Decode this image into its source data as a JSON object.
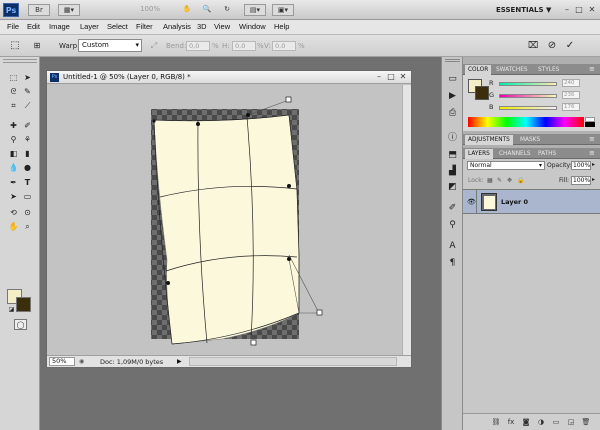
{
  "appbar": {
    "logo": "Ps",
    "zoom": "100%",
    "workspace": "ESSENTIALS",
    "workspace_arrow": "▼"
  },
  "menu": [
    "File",
    "Edit",
    "Image",
    "Layer",
    "Select",
    "Filter",
    "Analysis",
    "3D",
    "View",
    "Window",
    "Help"
  ],
  "options": {
    "warp_label": "Warp:",
    "warp_value": "Custom",
    "bend_label": "Bend:",
    "bend_value": "0,0",
    "h_label": "H:",
    "h_value": "0,0",
    "v_label": "V:",
    "v_value": "0,0",
    "pct": "%"
  },
  "document": {
    "title": "Untitled-1 @ 50% (Layer 0, RGB/8) *",
    "zoom": "50%",
    "doc_info": "Doc: 1,09M/0 bytes"
  },
  "color_panel": {
    "tabs": [
      "COLOR",
      "SWATCHES",
      "STYLES"
    ],
    "channels": [
      {
        "label": "R",
        "value": "240"
      },
      {
        "label": "G",
        "value": "236"
      },
      {
        "label": "B",
        "value": "176"
      }
    ],
    "fg_color": "#f3edc8",
    "bg_color": "#3a2e0c"
  },
  "adjustments_panel": {
    "tabs": [
      "ADJUSTMENTS",
      "MASKS"
    ]
  },
  "layers_panel": {
    "tabs": [
      "LAYERS",
      "CHANNELS",
      "PATHS"
    ],
    "blend_mode": "Normal",
    "opacity_label": "Opacity:",
    "opacity_value": "100%",
    "lock_label": "Lock:",
    "fill_label": "Fill:",
    "fill_value": "100%",
    "layer_name": "Layer 0"
  }
}
